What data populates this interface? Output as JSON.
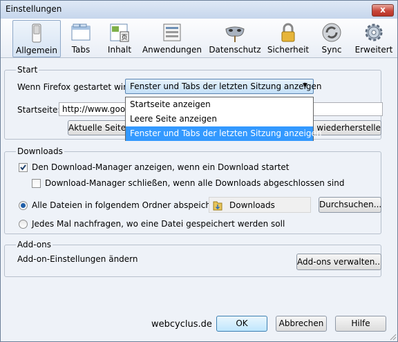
{
  "window": {
    "title": "Einstellungen",
    "close_label": "x"
  },
  "toolbar": {
    "items": [
      {
        "label": "Allgemein",
        "icon": "switch-icon",
        "selected": true
      },
      {
        "label": "Tabs",
        "icon": "tabs-icon",
        "selected": false
      },
      {
        "label": "Inhalt",
        "icon": "content-icon",
        "selected": false
      },
      {
        "label": "Anwendungen",
        "icon": "applications-icon",
        "selected": false
      },
      {
        "label": "Datenschutz",
        "icon": "privacy-mask-icon",
        "selected": false
      },
      {
        "label": "Sicherheit",
        "icon": "padlock-icon",
        "selected": false
      },
      {
        "label": "Sync",
        "icon": "sync-icon",
        "selected": false
      },
      {
        "label": "Erweitert",
        "icon": "gear-icon",
        "selected": false
      }
    ]
  },
  "start": {
    "title": "Start",
    "when_label": "Wenn Firefox gestartet wird:",
    "when_value": "Fenster und Tabs der letzten Sitzung anzeigen",
    "options": [
      "Startseite anzeigen",
      "Leere Seite anzeigen",
      "Fenster und Tabs der letzten Sitzung anzeigen"
    ],
    "selected_option": 2,
    "homepage_label": "Startseite:",
    "homepage_value": "http://www.goog",
    "current_page_button": "Aktuelle Seite v",
    "restore_button": "d wiederherstellen"
  },
  "downloads": {
    "title": "Downloads",
    "show_manager": {
      "label": "Den Download-Manager anzeigen, wenn ein Download startet",
      "checked": true
    },
    "close_manager": {
      "label": "Download-Manager schließen, wenn alle Downloads abgeschlossen sind",
      "checked": false
    },
    "save_all": {
      "label": "Alle Dateien in folgendem Ordner abspeichern:",
      "selected": true
    },
    "folder": "Downloads",
    "browse_button": "Durchsuchen...",
    "ask_each": {
      "label": "Jedes Mal nachfragen, wo eine Datei gespeichert werden soll",
      "selected": false
    }
  },
  "addons": {
    "title": "Add-ons",
    "description": "Add-on-Einstellungen ändern",
    "manage_button": "Add-ons verwalten..."
  },
  "footer": {
    "watermark": "webcyclus.de",
    "ok": "OK",
    "cancel": "Abbrechen",
    "help": "Hilfe"
  }
}
